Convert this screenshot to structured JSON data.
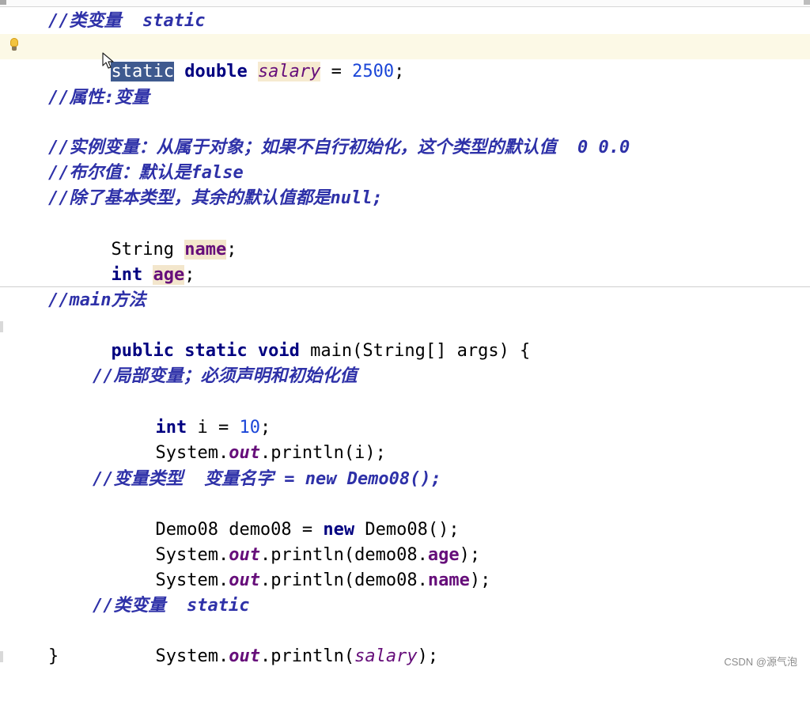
{
  "editor": {
    "lines": [
      {
        "key": "class_var_comment_1",
        "text": "//类变量  static"
      },
      {
        "key": "static_decl",
        "parts": [
          "static",
          " double ",
          "salary",
          " = ",
          "2500",
          ";"
        ]
      },
      {
        "key": "attr_comment",
        "text": "//属性:变量"
      },
      {
        "key": "instance_comment",
        "text": "//实例变量：从属于对象；如果不自行初始化，这个类型的默认值  0 0.0"
      },
      {
        "key": "bool_comment",
        "text": "//布尔值：默认是false"
      },
      {
        "key": "null_comment",
        "text": "//除了基本类型，其余的默认值都是null;"
      },
      {
        "key": "string_decl",
        "parts": [
          "String ",
          "name",
          ";"
        ]
      },
      {
        "key": "int_decl",
        "parts": [
          "int",
          " ",
          "age",
          ";"
        ]
      },
      {
        "key": "main_comment",
        "text": "//main方法"
      },
      {
        "key": "main_sig",
        "parts": [
          "public static void",
          " main(String[] args) {"
        ]
      },
      {
        "key": "local_comment",
        "text": "//局部变量；必须声明和初始化值"
      },
      {
        "key": "int_i",
        "parts": [
          "int",
          " i = ",
          "10",
          ";"
        ]
      },
      {
        "key": "print_i",
        "parts": [
          "System.",
          "out",
          ".println(i);"
        ]
      },
      {
        "key": "type_comment",
        "text": "//变量类型  变量名字 = new Demo08();"
      },
      {
        "key": "demo_decl",
        "parts": [
          "Demo08 demo08 = ",
          "new",
          " Demo08();"
        ]
      },
      {
        "key": "print_age",
        "parts": [
          "System.",
          "out",
          ".println(demo08.",
          "age",
          ");"
        ]
      },
      {
        "key": "print_name",
        "parts": [
          "System.",
          "out",
          ".println(demo08.",
          "name",
          ");"
        ]
      },
      {
        "key": "class_var_comment_2",
        "text": "//类变量  static"
      },
      {
        "key": "print_salary",
        "parts": [
          "System.",
          "out",
          ".println(",
          "salary",
          ");"
        ]
      },
      {
        "key": "close_brace",
        "text": "}"
      }
    ]
  },
  "icons": {
    "intention": "lightbulb-icon",
    "pointer": "mouse-pointer-icon"
  },
  "colors": {
    "comment": "#2e31a8",
    "keyword": "#000080",
    "number": "#1b46d8",
    "field": "#660e7a",
    "selection": "#3f5a8f",
    "caret_line": "#fcf9e6"
  },
  "watermark": "CSDN @源气泡"
}
